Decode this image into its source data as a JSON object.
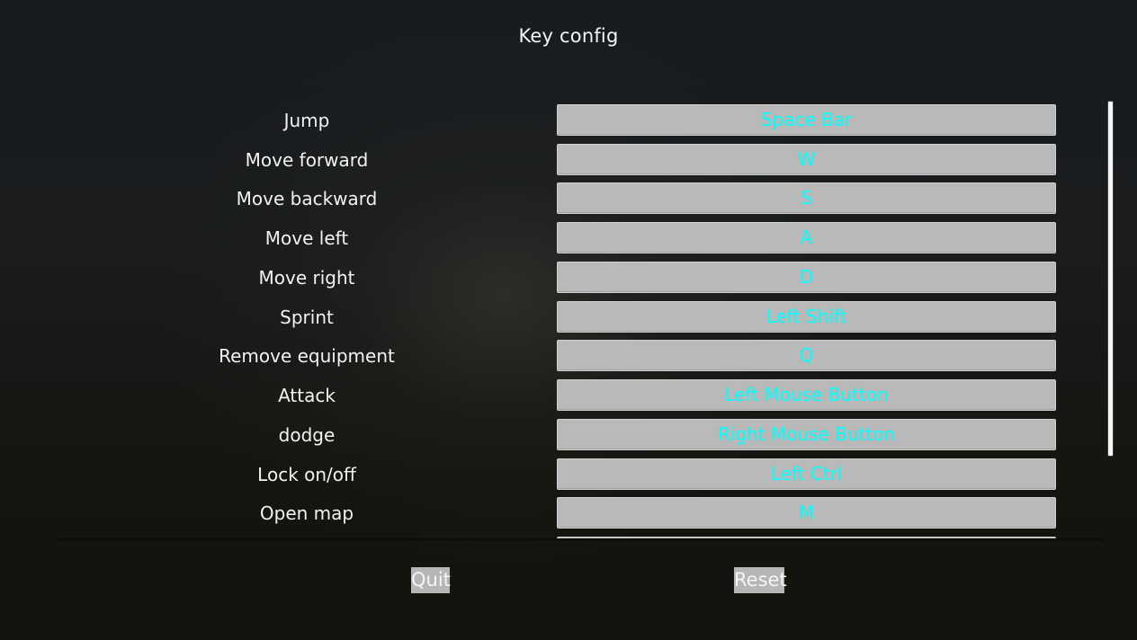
{
  "header": {
    "title": "Key config"
  },
  "bindings": [
    {
      "action": "Jump",
      "key": "Space Bar"
    },
    {
      "action": "Move forward",
      "key": "W"
    },
    {
      "action": "Move backward",
      "key": "S"
    },
    {
      "action": "Move left",
      "key": "A"
    },
    {
      "action": "Move right",
      "key": "D"
    },
    {
      "action": "Sprint",
      "key": "Left Shift"
    },
    {
      "action": "Remove equipment",
      "key": "Q"
    },
    {
      "action": "Attack",
      "key": "Left Mouse Button"
    },
    {
      "action": "dodge",
      "key": "Right Mouse Button"
    },
    {
      "action": "Lock on/off",
      "key": "Left Ctrl"
    },
    {
      "action": "Open map",
      "key": "M"
    },
    {
      "action": "",
      "key": ""
    }
  ],
  "footer": {
    "quit_label": "Quit",
    "reset_label": "Reset"
  },
  "colors": {
    "key_text": "#00ffff",
    "key_button_bg": "#b9b9b9",
    "footer_button_bg": "#b6b6b6"
  }
}
